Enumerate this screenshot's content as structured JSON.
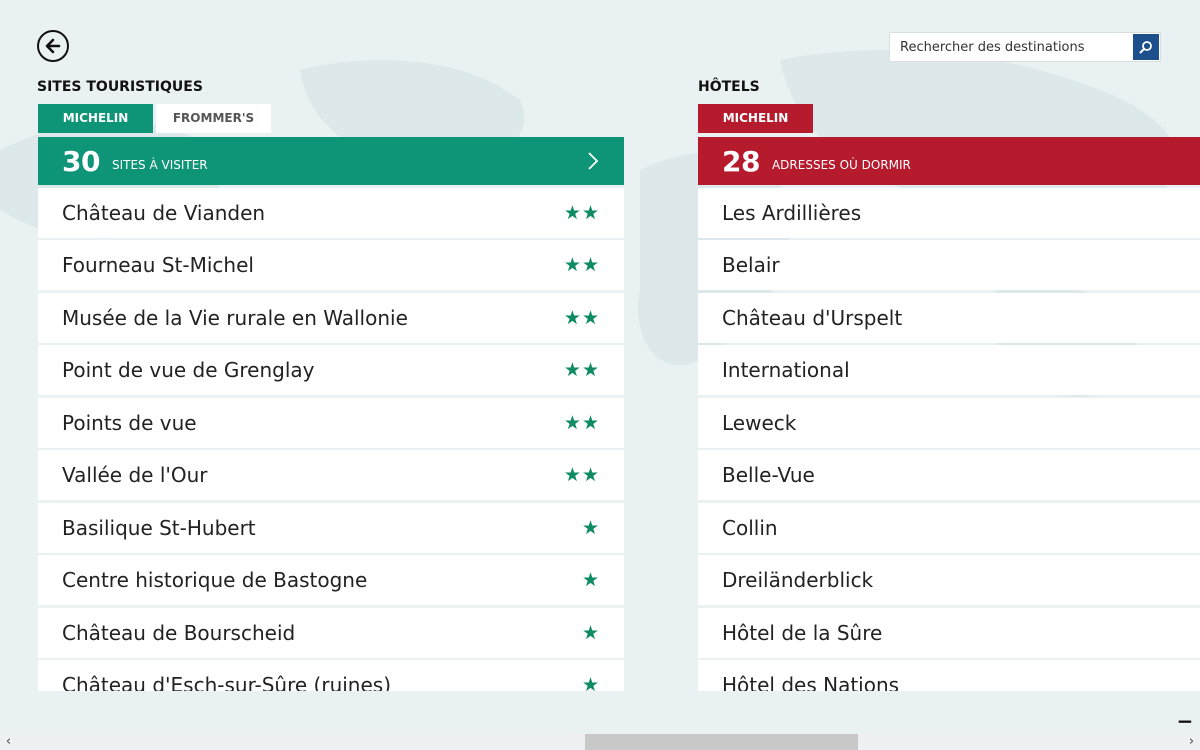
{
  "search": {
    "placeholder": "Rechercher des destinations"
  },
  "sights": {
    "title": "SITES TOURISTIQUES",
    "tabs": [
      {
        "label": "MICHELIN"
      },
      {
        "label": "FROMMER'S"
      }
    ],
    "count": "30",
    "count_label": "SITES À VISITER",
    "items": [
      {
        "name": "Château de Vianden",
        "stars": "★★"
      },
      {
        "name": "Fourneau St-Michel",
        "stars": "★★"
      },
      {
        "name": "Musée de la Vie rurale en Wallonie",
        "stars": "★★"
      },
      {
        "name": "Point de vue de Grenglay",
        "stars": "★★"
      },
      {
        "name": "Points de vue",
        "stars": "★★"
      },
      {
        "name": "Vallée de l'Our",
        "stars": "★★"
      },
      {
        "name": "Basilique St-Hubert",
        "stars": "★"
      },
      {
        "name": "Centre historique de Bastogne",
        "stars": "★"
      },
      {
        "name": "Château de Bourscheid",
        "stars": "★"
      },
      {
        "name": "Château d'Esch-sur-Sûre (ruines)",
        "stars": "★"
      }
    ]
  },
  "hotels": {
    "title": "HÔTELS",
    "tabs": [
      {
        "label": "MICHELIN"
      }
    ],
    "count": "28",
    "count_label": "ADRESSES OÙ DORMIR",
    "items": [
      {
        "name": "Les Ardillières"
      },
      {
        "name": "Belair"
      },
      {
        "name": "Château d'Urspelt"
      },
      {
        "name": "International"
      },
      {
        "name": "Leweck"
      },
      {
        "name": "Belle-Vue"
      },
      {
        "name": "Collin"
      },
      {
        "name": "Dreiländerblick"
      },
      {
        "name": "Hôtel de la Sûre"
      },
      {
        "name": "Hôtel des Nations"
      }
    ]
  },
  "icons": {
    "back": "back-arrow-icon",
    "search": "search-icon",
    "chevron": "chevron-right-icon",
    "star": "star-icon",
    "zoom": "semantic-zoom-minus-icon"
  },
  "colors": {
    "sights_accent": "#0e9477",
    "hotels_accent": "#b51a2d",
    "star_color": "#0e8a64",
    "search_button": "#1d4f8c"
  }
}
